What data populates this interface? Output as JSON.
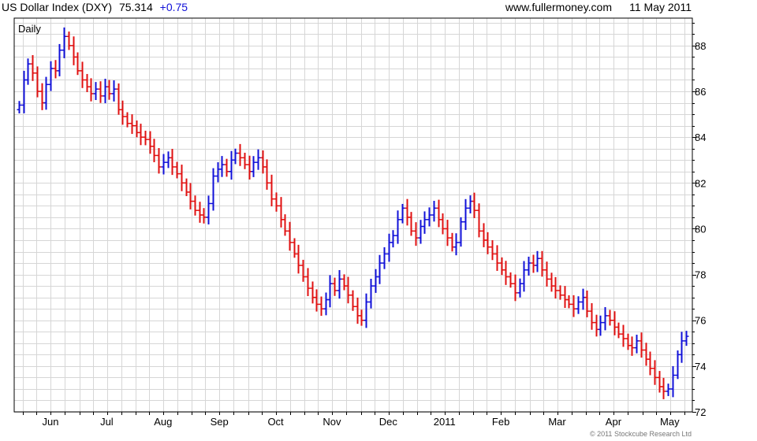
{
  "header": {
    "title": "US Dollar Index (DXY)",
    "last": "75.314",
    "change": "+0.75",
    "site": "www.fullermoney.com",
    "date": "11 May 2011"
  },
  "chart_label": "Daily",
  "copyright": "© 2011 Stockcube Research Ltd",
  "colors": {
    "up": "#1010d8",
    "down": "#e01010",
    "grid": "#d6d6d6",
    "change": "#1010d8",
    "label": "#1a1aa0"
  },
  "chart_data": {
    "type": "line",
    "style": "ohlc-bars",
    "title": "US Dollar Index (DXY)",
    "frequency": "Daily",
    "x_tick_labels": [
      "Jun",
      "Jul",
      "Aug",
      "Sep",
      "Oct",
      "Nov",
      "Dec",
      "2011",
      "Feb",
      "Mar",
      "Apr",
      "May"
    ],
    "y_tick_labels": [
      "72",
      "74",
      "76",
      "78",
      "80",
      "82",
      "84",
      "86",
      "88"
    ],
    "ylim": [
      72,
      89.2
    ],
    "y_axis_side": "right",
    "grid": true,
    "series": [
      {
        "values": [
          85.4,
          86.5,
          87.2,
          86.8,
          86.0,
          85.5,
          86.3,
          87.0,
          86.9,
          87.8,
          88.4,
          88.0,
          87.5,
          86.9,
          86.5,
          86.2,
          85.9,
          86.1,
          85.8,
          86.2,
          85.9,
          86.1,
          85.2,
          84.9,
          84.6,
          84.5,
          84.2,
          84.0,
          83.9,
          83.6,
          83.2,
          82.7,
          82.9,
          83.1,
          82.7,
          82.4,
          82.0,
          81.6,
          81.2,
          80.8,
          80.6,
          80.5,
          81.1,
          82.3,
          82.6,
          82.8,
          82.5,
          83.0,
          83.3,
          83.1,
          82.8,
          82.5,
          82.9,
          83.1,
          82.7,
          82.0,
          81.3,
          81.0,
          80.4,
          79.9,
          79.4,
          78.9,
          78.4,
          77.9,
          77.4,
          77.0,
          76.7,
          76.5,
          76.9,
          77.6,
          77.3,
          77.8,
          77.5,
          77.1,
          76.6,
          76.2,
          76.0,
          76.8,
          77.5,
          77.9,
          78.5,
          78.9,
          79.4,
          79.7,
          80.4,
          80.9,
          80.5,
          79.9,
          79.6,
          80.1,
          80.4,
          80.6,
          80.9,
          80.4,
          80.0,
          79.6,
          79.2,
          79.4,
          80.3,
          80.9,
          81.2,
          80.8,
          79.9,
          79.5,
          79.2,
          78.9,
          78.5,
          78.2,
          77.9,
          77.6,
          77.2,
          77.6,
          78.2,
          78.5,
          78.4,
          78.7,
          78.2,
          77.8,
          77.5,
          77.3,
          77.1,
          76.9,
          76.7,
          76.5,
          76.8,
          77.0,
          76.4,
          75.9,
          75.6,
          75.9,
          76.2,
          76.0,
          75.7,
          75.4,
          75.2,
          74.9,
          74.8,
          75.1,
          74.7,
          74.3,
          73.9,
          73.5,
          73.1,
          72.9,
          73.0,
          73.6,
          74.5,
          75.1,
          75.3
        ]
      }
    ]
  }
}
